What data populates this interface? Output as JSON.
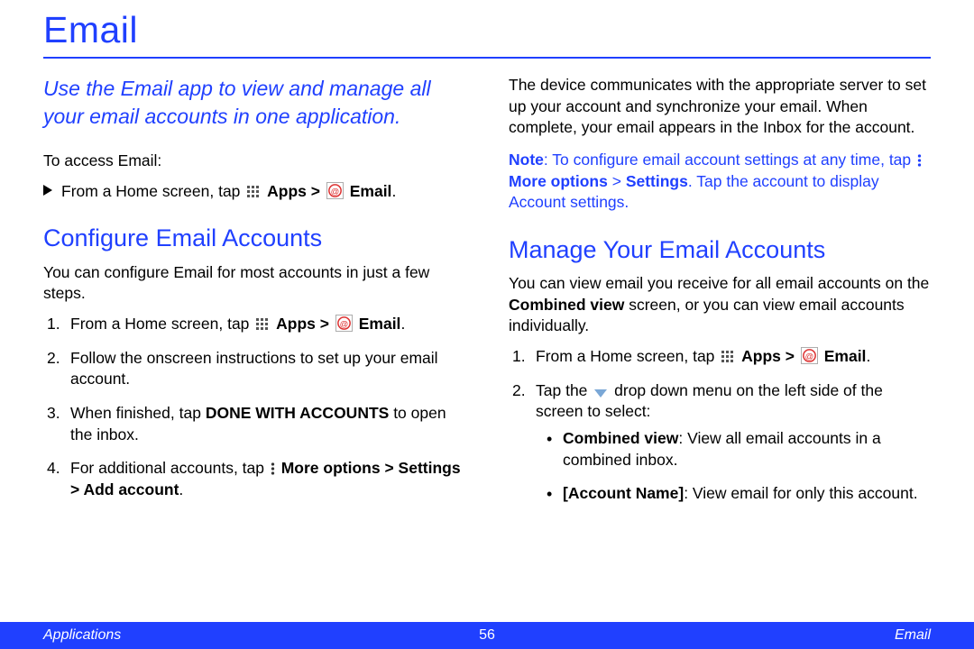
{
  "title": "Email",
  "intro": "Use the Email app to view and manage all your email accounts in one application.",
  "access_label": "To access Email:",
  "access_step_pre": "From a Home screen, tap ",
  "apps_label": "Apps",
  "gt": " > ",
  "email_label": "Email",
  "period": ".",
  "left": {
    "h2": "Configure Email Accounts",
    "p": "You can configure Email for most accounts in just a few steps.",
    "s1_pre": "From a Home screen, tap ",
    "s2": "Follow the onscreen instructions to set up your email account.",
    "s3_pre": "When finished, tap ",
    "s3_b": "DONE WITH ACCOUNTS",
    "s3_post": " to open the inbox.",
    "s4_pre": "For additional accounts, tap ",
    "s4_b1": "More options",
    "s4_mid": " > ",
    "s4_b2": "Settings",
    "s4_mid2": " > ",
    "s4_b3": "Add account",
    "s4_post": "."
  },
  "right": {
    "p1": "The device communicates with the appropriate server to set up your account and synchronize your email. When complete, your email appears in the Inbox for the account.",
    "note_pre": "Note",
    "note_text1": ": To configure email account settings at any time, tap ",
    "note_b1": "More options",
    "note_mid": " > ",
    "note_b2": "Settings",
    "note_text2": ". Tap the account to display Account settings.",
    "h2": "Manage Your Email Accounts",
    "p2_pre": "You can view email you receive for all email accounts on the ",
    "p2_b": "Combined view",
    "p2_post": " screen, or you can view email accounts individually.",
    "s1_pre": "From a Home screen, tap ",
    "s2_pre": "Tap the ",
    "s2_post": " drop down menu on the left side of the screen to select:",
    "b1_b": "Combined view",
    "b1_post": ": View all email accounts in a combined inbox.",
    "b2_b": "[Account Name]",
    "b2_post": ": View email for only this account."
  },
  "footer": {
    "left": "Applications",
    "page": "56",
    "right": "Email"
  }
}
